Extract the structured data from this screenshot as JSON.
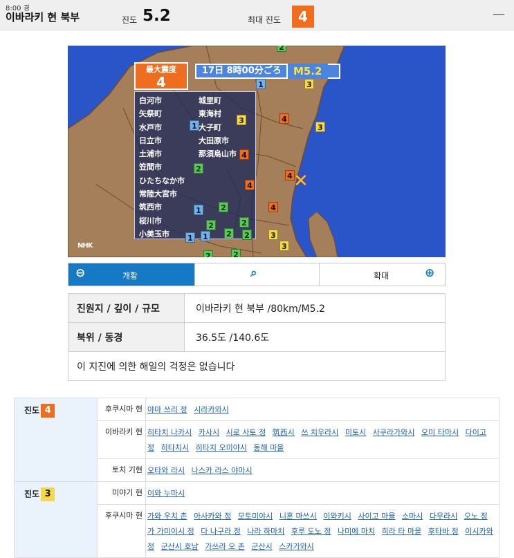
{
  "header": {
    "time": "8:00 경",
    "region": "이바라키 현 북부",
    "magnitude_label": "진도",
    "magnitude_value": "5.2",
    "max_intensity_label": "최대 진도",
    "max_intensity_value": "4",
    "collapse_symbol": "—"
  },
  "map": {
    "banner_title": "最大震度",
    "banner_value": "4",
    "banner_time": "17日 8時00分ごろ",
    "banner_mag": "M5.2",
    "cities_left": [
      "白河市",
      "矢祭町",
      "水戸市",
      "日立市",
      "土浦市",
      "笠間市",
      "ひたちなか市",
      "常陸大宮市",
      "筑西市",
      "桜川市",
      "小美玉市"
    ],
    "cities_right": [
      "城里町",
      "東海村",
      "大子町",
      "大田原市",
      "那須烏山市"
    ],
    "logo": "NHK",
    "markers": [
      {
        "v": "2",
        "c": "i2"
      },
      {
        "v": "1",
        "c": "i1"
      },
      {
        "v": "3",
        "c": "i3"
      },
      {
        "v": "3",
        "c": "i3"
      },
      {
        "v": "4",
        "c": "i4"
      },
      {
        "v": "3",
        "c": "i3"
      },
      {
        "v": "1",
        "c": "i1"
      },
      {
        "v": "4",
        "c": "i4"
      },
      {
        "v": "2",
        "c": "i2"
      },
      {
        "v": "4",
        "c": "i4"
      },
      {
        "v": "4",
        "c": "i4"
      },
      {
        "v": "2",
        "c": "i2"
      },
      {
        "v": "1",
        "c": "i1"
      },
      {
        "v": "2",
        "c": "i2"
      },
      {
        "v": "4",
        "c": "i4"
      },
      {
        "v": "2",
        "c": "i2"
      },
      {
        "v": "1",
        "c": "i1"
      },
      {
        "v": "2",
        "c": "i2"
      },
      {
        "v": "2",
        "c": "i2"
      },
      {
        "v": "3",
        "c": "i3"
      },
      {
        "v": "1",
        "c": "i1"
      },
      {
        "v": "3",
        "c": "i3"
      },
      {
        "v": "2",
        "c": "i2"
      },
      {
        "v": "2",
        "c": "i2"
      }
    ],
    "colors": {
      "sea": "#2a55c9",
      "land": "#a57e5a",
      "i4": "#ee6d1f",
      "i3": "#f5d94a",
      "i2": "#5bc65a",
      "i1": "#6fb3ea"
    }
  },
  "zoom": {
    "overview_label": "개황",
    "zoom_label": "확대",
    "zoom_out_icon": "zoom-out-icon",
    "search_icon": "search-icon",
    "zoom_in_icon": "zoom-in-icon"
  },
  "info": {
    "epicenter_label": "진원지 / 깊이 / 규모",
    "epicenter_value": "이바라키 현 북부 /80km/M5.2",
    "coord_label": "북위 / 동경",
    "coord_value": "36.5도 /140.6도",
    "tsunami_note": "이 지진에 의한 해일의 걱정은 없습니다"
  },
  "list": {
    "level_label": "진도",
    "groups": [
      {
        "level": "4",
        "rows": [
          {
            "pref": "후쿠시마 현",
            "cities": [
              "야마 쓰리 정",
              "시라카와시"
            ]
          },
          {
            "pref": "이바라키 현",
            "cities": [
              "히타치 나카시",
              "카사시",
              "시로 사토 정",
              "筑西시",
              "쓰 치우라시",
              "미토시",
              "사쿠라가와시",
              "오미 타마시",
              "다이고 정",
              "히타치시",
              "히타치 오미야시",
              "동해 마을"
            ]
          },
          {
            "pref": "토치 기현",
            "cities": [
              "오타와 라시",
              "나스카 라스 야마시"
            ]
          }
        ]
      },
      {
        "level": "3",
        "rows": [
          {
            "pref": "미야기 현",
            "cities": [
              "이와 누마시"
            ]
          },
          {
            "pref": "후쿠시마 현",
            "cities": [
              "가와 우치 촌",
              "아사카와 정",
              "모토미야시",
              "니혼 마쓰시",
              "이와키시",
              "사이고 마을",
              "소마시",
              "다무라시",
              "오노 정",
              "가 가미이시 정",
              "다 나구라 정",
              "나라 하마치",
              "후루 도노 정",
              "나미에 마치",
              "히라 타 마을",
              "후타바 정",
              "이시카와 정",
              "군산시 호남",
              "가쓰라 오 촌",
              "군산시",
              "스카가와시"
            ]
          }
        ]
      }
    ]
  }
}
